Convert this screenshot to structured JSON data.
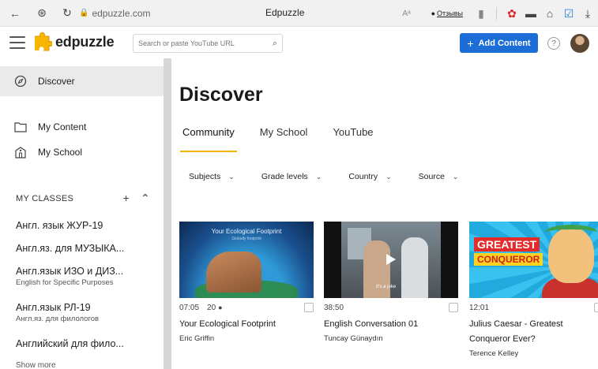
{
  "browser": {
    "url": "edpuzzle.com",
    "tab_title": "Edpuzzle",
    "feedback_label": "Отзывы"
  },
  "header": {
    "logo_text": "edpuzzle",
    "search_placeholder": "Search or paste YouTube URL",
    "add_content_label": "Add Content",
    "help_label": "?"
  },
  "sidebar": {
    "items": [
      {
        "label": "Discover"
      },
      {
        "label": "My Content"
      },
      {
        "label": "My School"
      }
    ],
    "classes_heading": "MY CLASSES",
    "classes": [
      {
        "title": "Англ. язык ЖУР-19",
        "subtitle": ""
      },
      {
        "title": "Англ.яз. для МУЗЫКА...",
        "subtitle": ""
      },
      {
        "title": "Англ.язык ИЗО и ДИЗ...",
        "subtitle": "English for Specific Purposes"
      },
      {
        "title": "Англ.язык РЛ-19",
        "subtitle": "Англ.яз. для филологов"
      },
      {
        "title": "Английский для фило...",
        "subtitle": ""
      }
    ],
    "show_more": "Show more"
  },
  "main": {
    "title": "Discover",
    "tabs": [
      {
        "label": "Community"
      },
      {
        "label": "My School"
      },
      {
        "label": "YouTube"
      }
    ],
    "filters": [
      {
        "label": "Subjects"
      },
      {
        "label": "Grade levels"
      },
      {
        "label": "Country"
      },
      {
        "label": "Source"
      }
    ],
    "cards": [
      {
        "duration": "07:05",
        "count": "20",
        "title": "Your Ecological Footprint",
        "author": "Eric Griffin",
        "thumb_text": "Your Ecological Footprint",
        "thumb_sub": "Globally footprint"
      },
      {
        "duration": "38:50",
        "count": "",
        "title": "English Conversation 01",
        "author": "Tuncay Günaydın",
        "thumb_caption": "It's a joke"
      },
      {
        "duration": "12:01",
        "count": "",
        "title": "Julius Caesar - Greatest Conqueror Ever?",
        "author": "Terence Kelley",
        "badge1": "GREATEST",
        "badge2": "CONQUEROR"
      }
    ]
  }
}
